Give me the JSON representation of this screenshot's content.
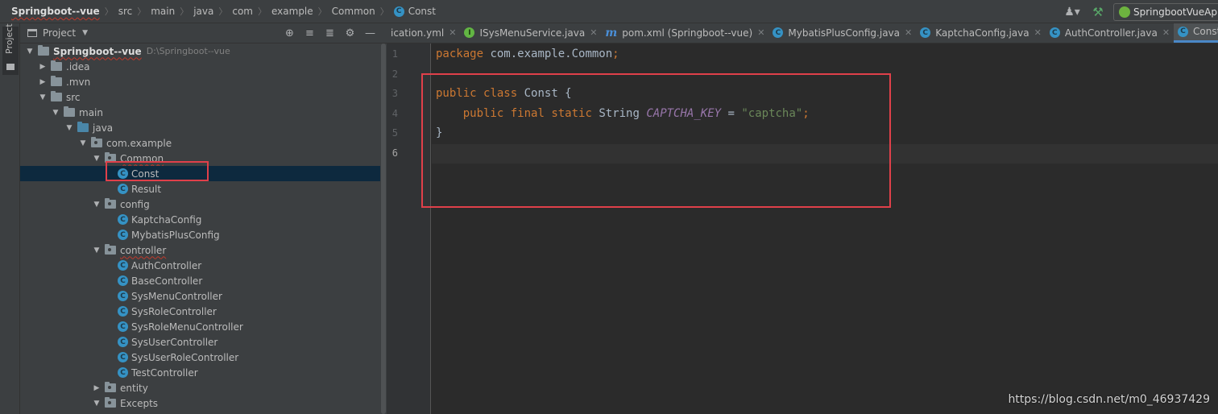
{
  "breadcrumb": {
    "items": [
      "Springboot--vue",
      "src",
      "main",
      "java",
      "com",
      "example",
      "Common",
      "Const"
    ],
    "class_icon_letter": "C"
  },
  "toolbar": {
    "run_config_label": "SpringbootVueAp",
    "icons": [
      "user-icon",
      "hammer-icon",
      "spring-icon"
    ]
  },
  "stripe": {
    "label": "Project"
  },
  "project_panel": {
    "title": "Project",
    "tools": [
      "target-icon",
      "expand-all-icon",
      "collapse-all-icon",
      "gear-icon",
      "minimize-icon"
    ],
    "root": {
      "name": "Springboot--vue",
      "path": "D:\\Springboot--vue"
    },
    "tree": [
      {
        "label": ".idea",
        "kind": "folder"
      },
      {
        "label": ".mvn",
        "kind": "folder"
      },
      {
        "label": "src",
        "kind": "folder"
      },
      {
        "label": "main",
        "kind": "folder"
      },
      {
        "label": "java",
        "kind": "source-folder"
      },
      {
        "label": "com.example",
        "kind": "package"
      },
      {
        "label": "Common",
        "kind": "package"
      },
      {
        "label": "Const",
        "kind": "class",
        "selected": true
      },
      {
        "label": "Result",
        "kind": "class"
      },
      {
        "label": "config",
        "kind": "package"
      },
      {
        "label": "KaptchaConfig",
        "kind": "class"
      },
      {
        "label": "MybatisPlusConfig",
        "kind": "class"
      },
      {
        "label": "controller",
        "kind": "package"
      },
      {
        "label": "AuthController",
        "kind": "class"
      },
      {
        "label": "BaseController",
        "kind": "class"
      },
      {
        "label": "SysMenuController",
        "kind": "class"
      },
      {
        "label": "SysRoleController",
        "kind": "class"
      },
      {
        "label": "SysRoleMenuController",
        "kind": "class"
      },
      {
        "label": "SysUserController",
        "kind": "class"
      },
      {
        "label": "SysUserRoleController",
        "kind": "class"
      },
      {
        "label": "TestController",
        "kind": "class"
      },
      {
        "label": "entity",
        "kind": "package"
      },
      {
        "label": "Excepts",
        "kind": "package"
      }
    ]
  },
  "tabs": [
    {
      "label": "ication.yml",
      "icon": "none"
    },
    {
      "label": "ISysMenuService.java",
      "icon": "interface-icon",
      "icon_letter": "I"
    },
    {
      "label": "pom.xml (Springboot--vue)",
      "icon": "maven-icon",
      "icon_letter": "m"
    },
    {
      "label": "MybatisPlusConfig.java",
      "icon": "class-icon",
      "icon_letter": "C"
    },
    {
      "label": "KaptchaConfig.java",
      "icon": "class-icon",
      "icon_letter": "C"
    },
    {
      "label": "AuthController.java",
      "icon": "class-icon",
      "icon_letter": "C"
    },
    {
      "label": "Const.java",
      "icon": "class-icon",
      "icon_letter": "C",
      "active": true
    }
  ],
  "editor": {
    "line_numbers": [
      "1",
      "2",
      "3",
      "4",
      "5",
      "6"
    ],
    "current_line": 6,
    "code": {
      "l1_kw": "package",
      "l1_rest": " com.example.Common",
      "l1_semi": ";",
      "l3_kw1": "public",
      "l3_kw2": "class",
      "l3_rest": " Const {",
      "l4_kw1": "public",
      "l4_kw2": "final",
      "l4_kw3": "static",
      "l4_type": " String ",
      "l4_const": "CAPTCHA_KEY",
      "l4_eq": " = ",
      "l4_str": "\"captcha\"",
      "l4_semi": ";",
      "l5": "}"
    }
  },
  "watermark": "https://blog.csdn.net/m0_46937429",
  "colors": {
    "highlight_box": "#e0404a",
    "keyword": "#cc7832",
    "string": "#6a8759",
    "constant": "#9876aa",
    "selection": "#0d293e"
  }
}
